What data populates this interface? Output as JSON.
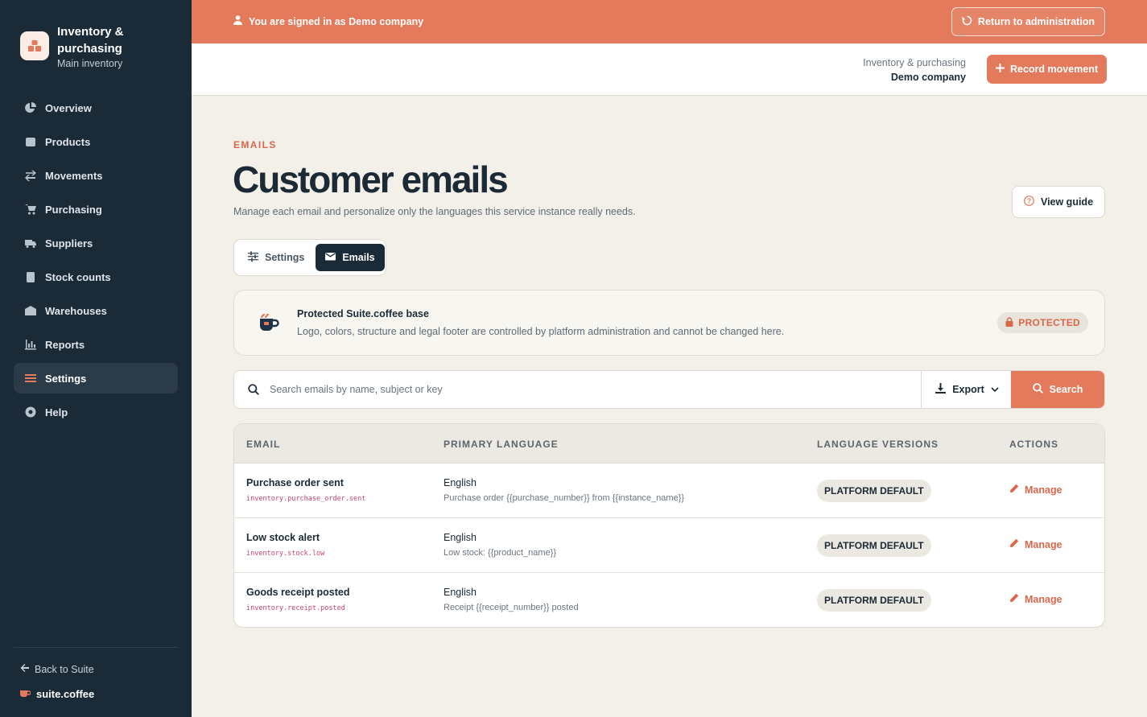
{
  "sidebar": {
    "brand_title": "Inventory & purchasing",
    "brand_subtitle": "Main inventory",
    "items": [
      {
        "label": "Overview",
        "icon": "pie-chart-icon"
      },
      {
        "label": "Products",
        "icon": "box-icon"
      },
      {
        "label": "Movements",
        "icon": "arrows-exchange-icon"
      },
      {
        "label": "Purchasing",
        "icon": "cart-icon"
      },
      {
        "label": "Suppliers",
        "icon": "truck-icon"
      },
      {
        "label": "Stock counts",
        "icon": "clipboard-check-icon"
      },
      {
        "label": "Warehouses",
        "icon": "warehouse-icon"
      },
      {
        "label": "Reports",
        "icon": "bar-chart-icon"
      },
      {
        "label": "Settings",
        "icon": "sliders-icon",
        "active": true
      },
      {
        "label": "Help",
        "icon": "lifebuoy-icon"
      }
    ],
    "back_label": "Back to Suite",
    "suite_name": "suite.coffee"
  },
  "banner": {
    "text": "You are signed in as Demo company",
    "return_label": "Return to administration"
  },
  "topbar": {
    "context_sub": "Inventory & purchasing",
    "context_main": "Demo company",
    "record_label": "Record movement"
  },
  "page": {
    "eyebrow": "EMAILS",
    "title": "Customer emails",
    "description": "Manage each email and personalize only the languages this service instance really needs.",
    "guide_label": "View guide"
  },
  "tabs": [
    {
      "label": "Settings",
      "active": false
    },
    {
      "label": "Emails",
      "active": true
    }
  ],
  "protected_card": {
    "title": "Protected Suite.coffee base",
    "description": "Logo, colors, structure and legal footer are controlled by platform administration and cannot be changed here.",
    "badge": "PROTECTED"
  },
  "search": {
    "placeholder": "Search emails by name, subject or key",
    "value": "",
    "export_label": "Export",
    "search_label": "Search"
  },
  "table": {
    "headers": {
      "email": "EMAIL",
      "primary_language": "PRIMARY LANGUAGE",
      "language_versions": "LANGUAGE VERSIONS",
      "actions": "ACTIONS"
    },
    "rows": [
      {
        "name": "Purchase order sent",
        "key": "inventory.purchase_order.sent",
        "language": "English",
        "subject": "Purchase order {{purchase_number}} from {{instance_name}}",
        "versions": "PLATFORM DEFAULT",
        "action": "Manage"
      },
      {
        "name": "Low stock alert",
        "key": "inventory.stock.low",
        "language": "English",
        "subject": "Low stock: {{product_name}}",
        "versions": "PLATFORM DEFAULT",
        "action": "Manage"
      },
      {
        "name": "Goods receipt posted",
        "key": "inventory.receipt.posted",
        "language": "English",
        "subject": "Receipt {{receipt_number}} posted",
        "versions": "PLATFORM DEFAULT",
        "action": "Manage"
      }
    ]
  },
  "colors": {
    "accent": "#e47a5c",
    "sidebar_bg": "#1b2a37",
    "page_bg": "#f3f0ea",
    "key_text": "#c7456a"
  }
}
